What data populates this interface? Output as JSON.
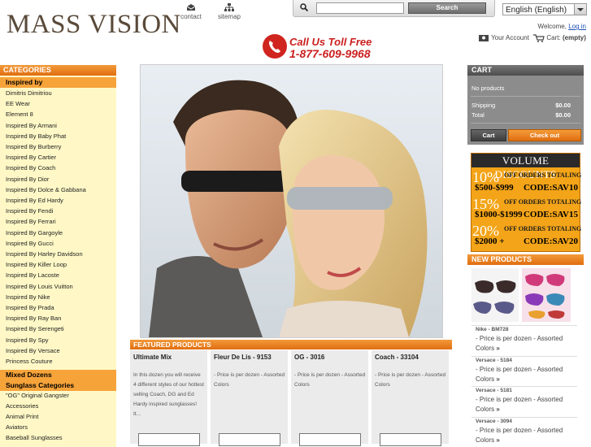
{
  "header": {
    "logo": "MASS VISION",
    "links": [
      {
        "label": "contact",
        "icon": "contact-icon"
      },
      {
        "label": "sitemap",
        "icon": "sitemap-icon"
      }
    ],
    "search": {
      "placeholder": "",
      "button": "Search"
    },
    "language": "English (English)",
    "welcome": "Welcome,",
    "login": "Log in",
    "account": "Your Account",
    "cart_link": "Cart:",
    "cart_status": "(empty)",
    "phone_line1": "Call Us Toll Free",
    "phone_line2": "1-877-609-9968"
  },
  "sidebar": {
    "heading": "CATEGORIES",
    "inspired_heading": "Inspired by",
    "inspired_items": [
      "Dimitris Dimitriou",
      "EE Wear",
      "Element 8",
      "Inspired By Armani",
      "Inspired By Baby Phat",
      "Inspired By Burberry",
      "Inspired By Cartier",
      "Inspired By Coach",
      "Inspired By Dior",
      "Inspired By Dolce & Gabbana",
      "Inspired By Ed Hardy",
      "Inspired By Fendi",
      "Inspired By Ferrari",
      "Inspired By Gargoyle",
      "Inspired By Gucci",
      "Inspired By Harley Davidson",
      "Inspired By Killer Loop",
      "Inspired By Lacoste",
      "Inspired By Louis Vuitton",
      "Inspired By Nike",
      "Inspired By Prada",
      "Inspired By Ray Ban",
      "Inspired By Serengeti",
      "Inspired By Spy",
      "Inspired By Versace",
      "Princess Couture"
    ],
    "mixed_heading": "Mixed Dozens",
    "sunglass_heading": "Sunglass Categories",
    "sunglass_items": [
      "\"OG\" Original Gangster",
      "Accessories",
      "Animal Print",
      "Aviators",
      "Baseball Sunglasses"
    ]
  },
  "featured": {
    "heading": "FEATURED PRODUCTS",
    "products": [
      {
        "title": "Ultimate Mix",
        "desc": "In this dozen you will receive 4 different styles of our hottest selling Coach, DG and Ed Hardy inspired sunglasses!  It..."
      },
      {
        "title": "Fleur De Lis - 9153",
        "desc": "- Price is per dozen - Assorted Colors"
      },
      {
        "title": "OG - 3016",
        "desc": "- Price is per dozen - Assorted Colors"
      },
      {
        "title": "Coach - 33104",
        "desc": "- Price is per dozen - Assorted Colors"
      }
    ]
  },
  "cart": {
    "heading": "CART",
    "empty": "No products",
    "shipping_label": "Shipping",
    "shipping_value": "$0.00",
    "total_label": "Total",
    "total_value": "$0.00",
    "cart_button": "Cart",
    "checkout_button": "Check out"
  },
  "volume": {
    "title": "VOLUME DISCOUNTS",
    "tiers": [
      {
        "pct": "10%",
        "off": "OFF ORDERS TOTALING",
        "range": "$500-$999",
        "code": "CODE:SAV10"
      },
      {
        "pct": "15%",
        "off": "OFF ORDERS TOTALING",
        "range": "$1000-$1999",
        "code": "CODE:SAV15"
      },
      {
        "pct": "20%",
        "off": "OFF ORDERS TOTALING",
        "range": "$2000 +",
        "code": "CODE:SAV20"
      }
    ]
  },
  "new_products": {
    "heading": "NEW PRODUCTS",
    "items": [
      {
        "name": "Nike - BM728",
        "desc": "- Price is per dozen - Assorted Colors"
      },
      {
        "name": "Versace - 5184",
        "desc": "- Price is per dozen - Assorted Colors"
      },
      {
        "name": "Versace - 5181",
        "desc": "- Price is per dozen - Assorted Colors"
      },
      {
        "name": "Versace - 3094",
        "desc": "- Price is per dozen - Assorted Colors"
      }
    ]
  },
  "colors": {
    "accent_orange": "#e8801f",
    "sidebar_bg": "#fff8c6",
    "phone_red": "#cc1f1f"
  }
}
